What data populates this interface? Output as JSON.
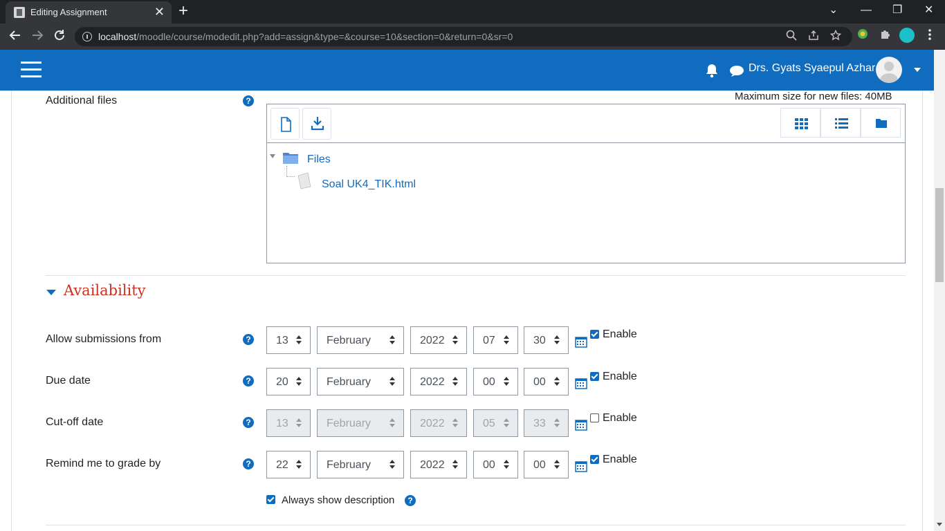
{
  "browser": {
    "tab_title": "Editing Assignment",
    "tab_close": "✕",
    "new_tab": "+",
    "url_host": "localhost",
    "url_path": "/moodle/course/modedit.php?add=assign&type=&course=10&section=0&return=0&sr=0",
    "min": "—",
    "restore": "❐",
    "close": "✕",
    "chevron": "⌄"
  },
  "navbar": {
    "username": "Drs. Gyats Syaepul Azhar",
    "brand_color": "#0f6cbf"
  },
  "additional_files": {
    "label": "Additional files",
    "max_size": "Maximum size for new files: 40MB",
    "folder": "Files",
    "file": "Soal UK4_TIK.html"
  },
  "availability": {
    "title": "Availability",
    "title_color": "#ca3120",
    "rows": [
      {
        "label": "Allow submissions from",
        "day": "13",
        "month": "February",
        "year": "2022",
        "hour": "07",
        "minute": "30",
        "enabled": true,
        "enable_label": "Enable"
      },
      {
        "label": "Due date",
        "day": "20",
        "month": "February",
        "year": "2022",
        "hour": "00",
        "minute": "00",
        "enabled": true,
        "enable_label": "Enable"
      },
      {
        "label": "Cut-off date",
        "day": "13",
        "month": "February",
        "year": "2022",
        "hour": "05",
        "minute": "33",
        "enabled": false,
        "enable_label": "Enable"
      },
      {
        "label": "Remind me to grade by",
        "day": "22",
        "month": "February",
        "year": "2022",
        "hour": "00",
        "minute": "00",
        "enabled": true,
        "enable_label": "Enable"
      }
    ],
    "always_show_description": "Always show description",
    "always_show_checked": true
  },
  "help_glyph": "?"
}
